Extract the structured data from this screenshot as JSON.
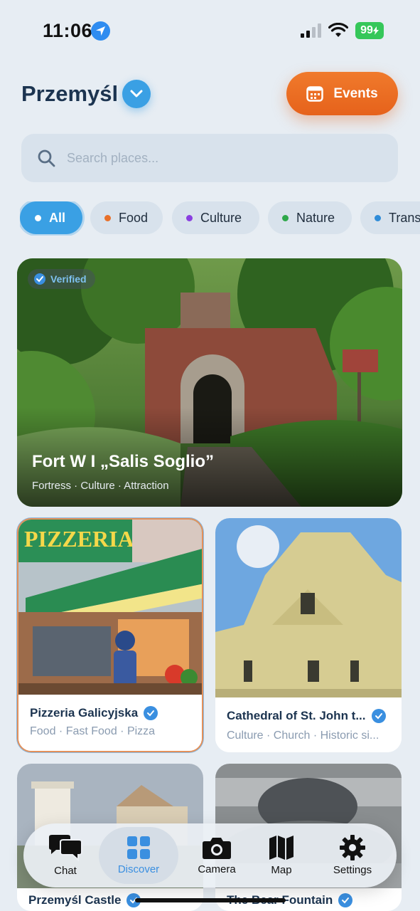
{
  "status_bar": {
    "time": "11:06",
    "battery": "99"
  },
  "header": {
    "city": "Przemyśl",
    "events_label": "Events"
  },
  "search": {
    "placeholder": "Search places..."
  },
  "filters": [
    {
      "label": "All",
      "dot_color": "#ffffff",
      "active": true
    },
    {
      "label": "Food",
      "dot_color": "#e8702a",
      "active": false
    },
    {
      "label": "Culture",
      "dot_color": "#8a3fe0",
      "active": false
    },
    {
      "label": "Nature",
      "dot_color": "#2ea84a",
      "active": false
    },
    {
      "label": "Trans",
      "dot_color": "#2f8cd8",
      "active": false
    }
  ],
  "featured": {
    "verified_label": "Verified",
    "title": "Fort W I „Salis Soglio”",
    "tags": "Fortress · Culture · Attraction"
  },
  "places": [
    {
      "name": "Pizzeria Galicyjska",
      "tags": "Food · Fast Food · Pizza"
    },
    {
      "name": "Cathedral of St. John t...",
      "tags": "Culture · Church · Historic si..."
    },
    {
      "name": "Przemyśl Castle",
      "tags": ""
    },
    {
      "name": "The Bear Fountain",
      "tags": ""
    }
  ],
  "tabs": [
    {
      "label": "Chat",
      "icon": "chat-icon"
    },
    {
      "label": "Discover",
      "icon": "grid-icon",
      "active": true
    },
    {
      "label": "Camera",
      "icon": "camera-icon"
    },
    {
      "label": "Map",
      "icon": "map-icon"
    },
    {
      "label": "Settings",
      "icon": "gear-icon"
    }
  ],
  "colors": {
    "accent": "#3aa0e4",
    "events": "#e8692a",
    "background": "#e7edf3"
  }
}
